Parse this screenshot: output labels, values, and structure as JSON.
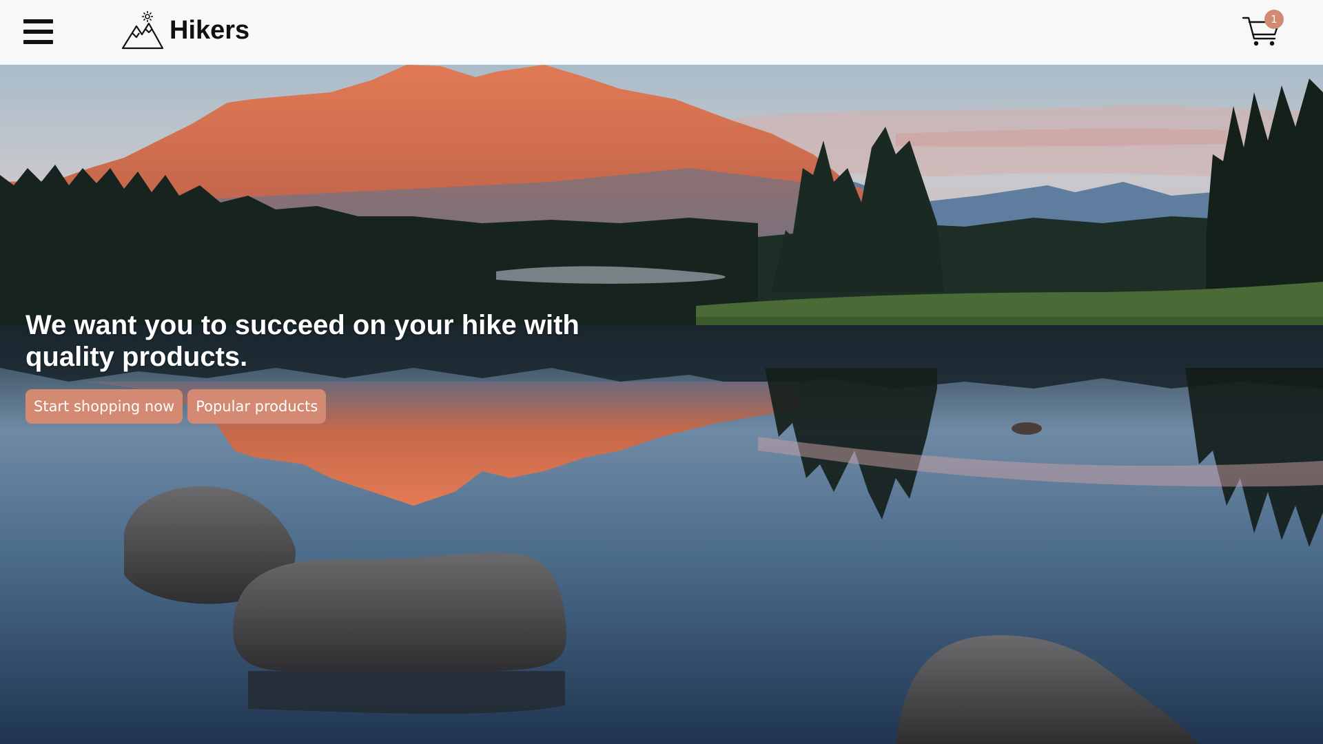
{
  "header": {
    "brand": "Hikers",
    "cart_count": "1"
  },
  "hero": {
    "headline": "We want you to succeed on your hike with quality products.",
    "buttons": [
      {
        "label": "Start shopping now"
      },
      {
        "label": "Popular products"
      }
    ]
  },
  "icons": {
    "menu": "hamburger-menu-icon",
    "logo": "mountain-sun-icon",
    "cart": "shopping-cart-icon"
  },
  "colors": {
    "accent": "#d48a72",
    "header_bg": "#f8f8f9",
    "text_dark": "#111111"
  }
}
